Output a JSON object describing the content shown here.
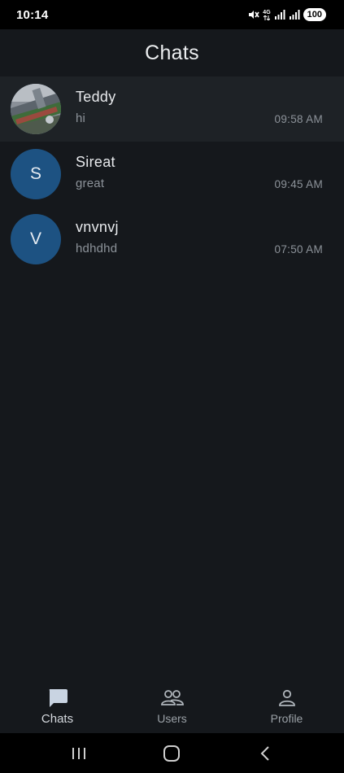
{
  "status_bar": {
    "time": "10:14",
    "network": "4G",
    "battery": "100"
  },
  "header": {
    "title": "Chats"
  },
  "chats": [
    {
      "name": "Teddy",
      "preview": "hi",
      "time": "09:58 AM",
      "avatar_type": "photo",
      "avatar_letter": ""
    },
    {
      "name": "Sireat",
      "preview": "great",
      "time": "09:45 AM",
      "avatar_type": "letter",
      "avatar_letter": "S"
    },
    {
      "name": "vnvnvj",
      "preview": "hdhdhd",
      "time": "07:50 AM",
      "avatar_type": "letter",
      "avatar_letter": "V"
    }
  ],
  "bottom_nav": {
    "items": [
      {
        "label": "Chats",
        "icon": "chat-bubble-icon",
        "active": true
      },
      {
        "label": "Users",
        "icon": "users-icon",
        "active": false
      },
      {
        "label": "Profile",
        "icon": "person-icon",
        "active": false
      }
    ]
  },
  "colors": {
    "background": "#15181c",
    "selected_row": "#1e2226",
    "avatar_blue": "#1d5282",
    "secondary_text": "#8d939a"
  }
}
